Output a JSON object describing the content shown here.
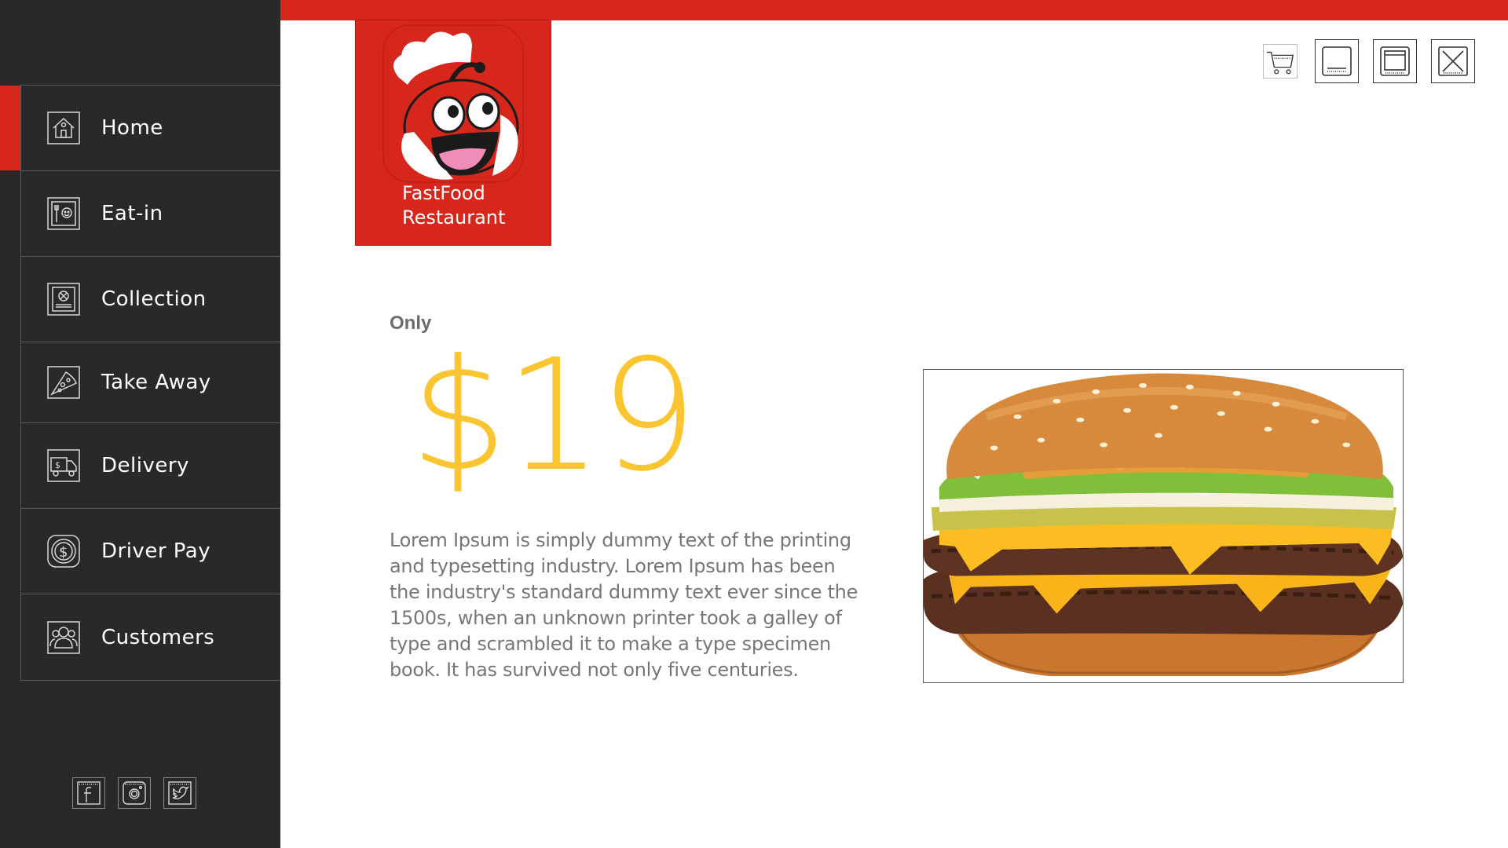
{
  "sidebar": {
    "items": [
      {
        "label": "Home",
        "icon": "home-icon",
        "active": true
      },
      {
        "label": "Eat-in",
        "icon": "eat-in-icon",
        "active": false
      },
      {
        "label": "Collection",
        "icon": "collection-icon",
        "active": false
      },
      {
        "label": "Take Away",
        "icon": "pizza-slice-icon",
        "active": false
      },
      {
        "label": "Delivery",
        "icon": "delivery-truck-icon",
        "active": false
      },
      {
        "label": "Driver Pay",
        "icon": "dollar-coin-icon",
        "active": false
      },
      {
        "label": "Customers",
        "icon": "customers-icon",
        "active": false
      }
    ],
    "social": [
      "facebook-icon",
      "instagram-icon",
      "twitter-icon"
    ]
  },
  "logo": {
    "line1": "FastFood",
    "line2": "Restaurant"
  },
  "controls": [
    "cart-icon",
    "minimize-icon",
    "maximize-icon",
    "close-icon"
  ],
  "main": {
    "only_label": "Only",
    "price": "$19",
    "description": "Lorem Ipsum is simply dummy text of the printing and typesetting industry. Lorem Ipsum has been the industry's standard dummy text ever since the 1500s, when an unknown printer took a galley of type and scrambled it to make a type specimen book. It has survived not only five centuries."
  },
  "colors": {
    "accent": "#d7261c",
    "sidebar_bg": "#2a292a",
    "price": "#fbc531",
    "text": "#767676"
  }
}
